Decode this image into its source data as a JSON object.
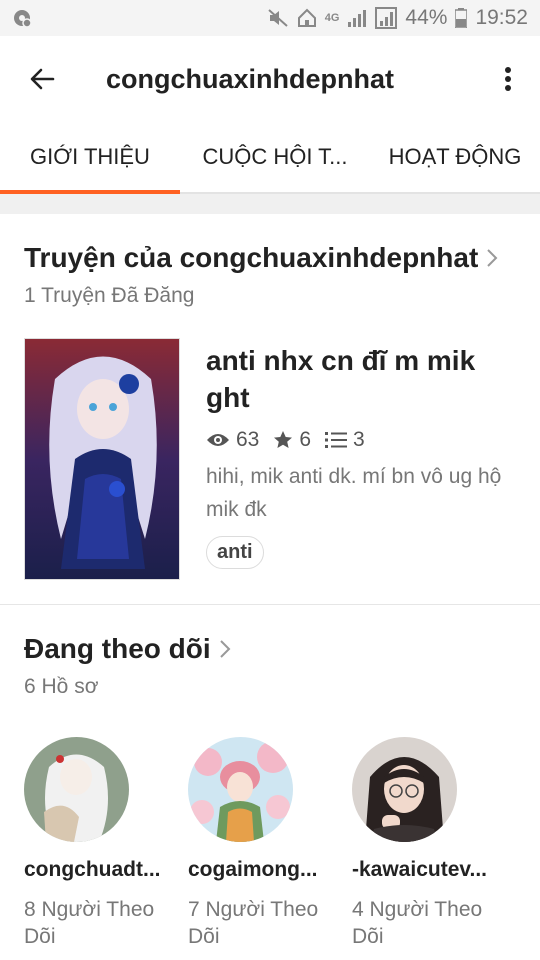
{
  "status": {
    "battery": "44%",
    "time": "19:52",
    "network": "4G"
  },
  "header": {
    "title": "congchuaxinhdepnhat"
  },
  "tabs": [
    {
      "label": "GIỚI THIỆU",
      "active": true
    },
    {
      "label": "CUỘC HỘI T..."
    },
    {
      "label": "HOẠT ĐỘNG"
    }
  ],
  "stories": {
    "title": "Truyện của congchuaxinhdepnhat",
    "subtitle": "1 Truyện Đã Đăng",
    "item": {
      "title": "anti nhx cn đĩ m mik ght",
      "views": "63",
      "votes": "6",
      "parts": "3",
      "description": "hihi, mik anti dk. mí bn vô ug hộ mik đk",
      "tag": "anti"
    }
  },
  "following": {
    "title": "Đang theo dõi",
    "subtitle": "6 Hồ sơ",
    "profiles": [
      {
        "name": "congchuadt...",
        "followers": "8 Người Theo Dõi"
      },
      {
        "name": "cogaimong...",
        "followers": "7 Người Theo Dõi"
      },
      {
        "name": "-kawaicutev...",
        "followers": "4 Người Theo Dõi"
      }
    ]
  },
  "colors": {
    "accent": "#ff6122",
    "muted": "#777777"
  }
}
